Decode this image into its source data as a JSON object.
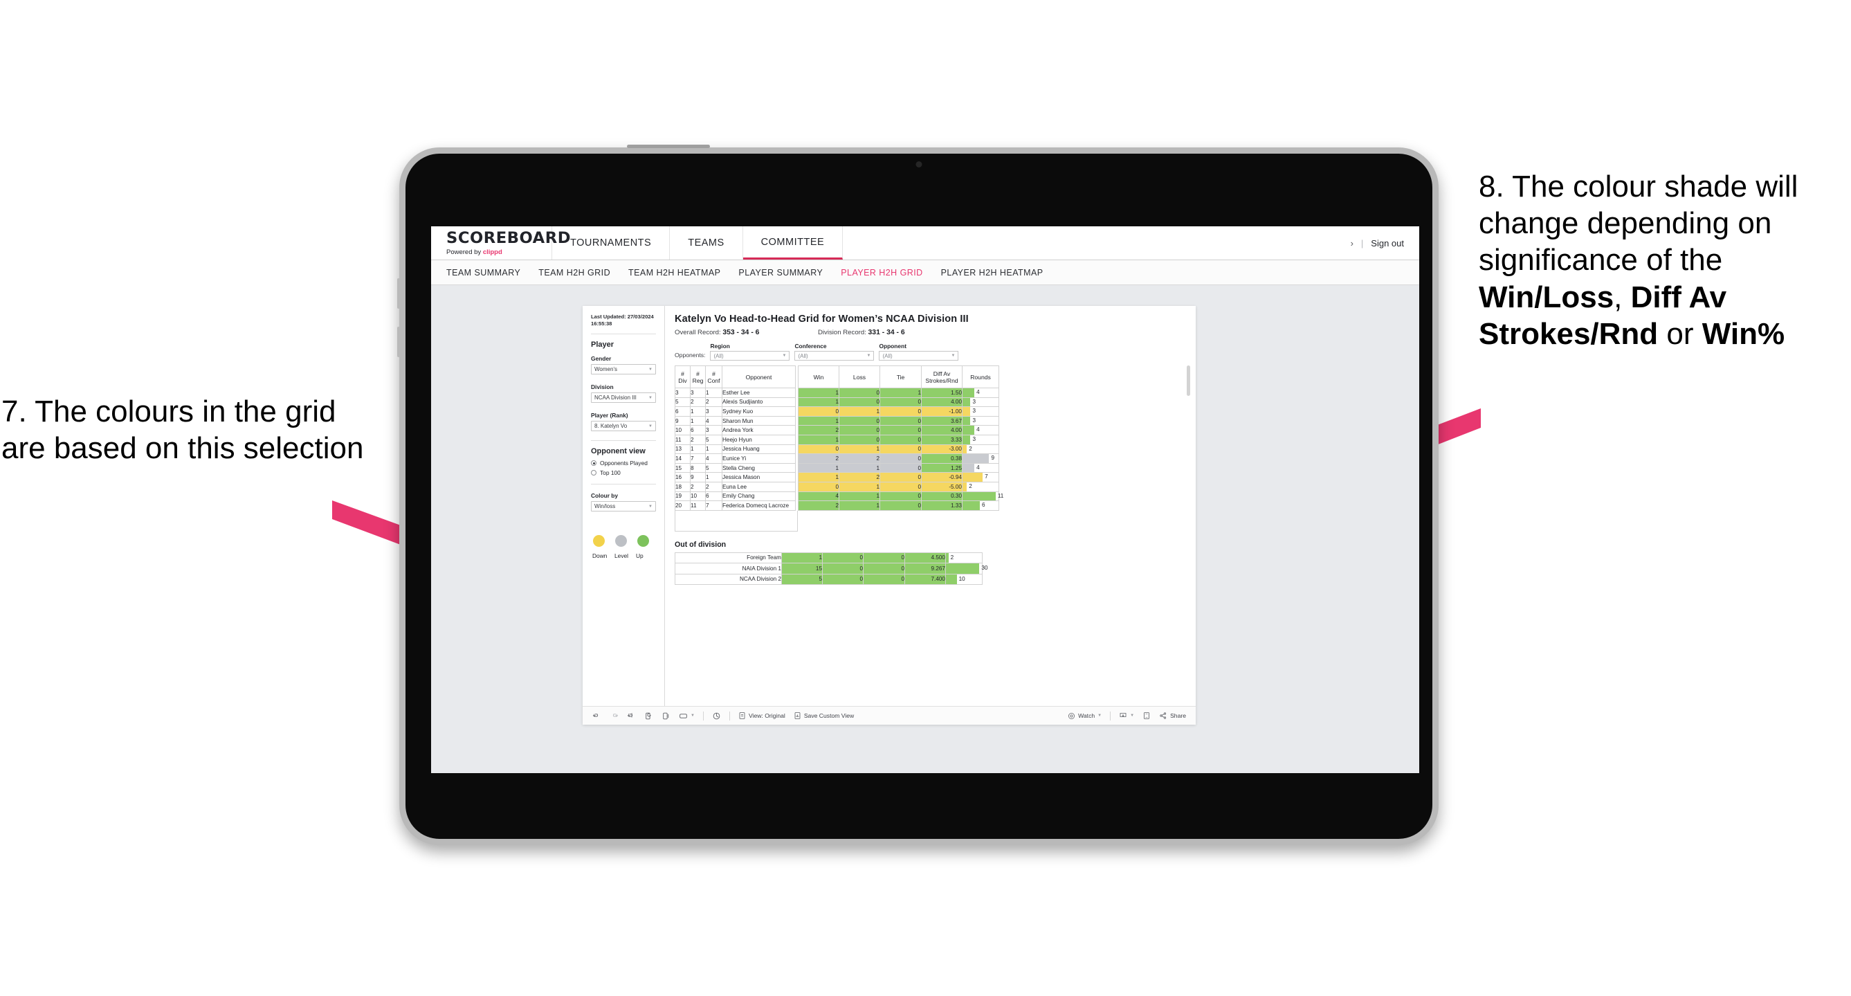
{
  "annotations": {
    "left": {
      "id": "7.",
      "text": "7. The colours in the grid are based on this selection"
    },
    "right": {
      "id": "8.",
      "prefix": "8. The colour shade will change depending on significance of the ",
      "bold1": "Win/Loss",
      "mid1": ", ",
      "bold2": "Diff Av Strokes/Rnd",
      "mid2": " or ",
      "bold3": "Win%"
    },
    "arrow_color": "#e8376f"
  },
  "app": {
    "brand": {
      "name": "SCOREBOARD",
      "sub_prefix": "Powered by ",
      "sub_brand": "clippd"
    },
    "nav_tabs": [
      {
        "label": "TOURNAMENTS",
        "active": false
      },
      {
        "label": "TEAMS",
        "active": false
      },
      {
        "label": "COMMITTEE",
        "active": true
      }
    ],
    "top_right": {
      "chevron": "›",
      "divider": "|",
      "sign_out": "Sign out"
    },
    "sub_tabs": [
      {
        "label": "TEAM SUMMARY",
        "active": false
      },
      {
        "label": "TEAM H2H GRID",
        "active": false
      },
      {
        "label": "TEAM H2H HEATMAP",
        "active": false
      },
      {
        "label": "PLAYER SUMMARY",
        "active": false
      },
      {
        "label": "PLAYER H2H GRID",
        "active": true
      },
      {
        "label": "PLAYER H2H HEATMAP",
        "active": false
      }
    ]
  },
  "sidebar": {
    "last_updated": "Last Updated: 27/03/2024 16:55:38",
    "player_heading": "Player",
    "fields": [
      {
        "label": "Gender",
        "value": "Women’s"
      },
      {
        "label": "Division",
        "value": "NCAA Division III"
      },
      {
        "label": "Player (Rank)",
        "value": "8. Katelyn Vo"
      }
    ],
    "opponent_view": {
      "heading": "Opponent view",
      "options": [
        {
          "label": "Opponents Played",
          "selected": true
        },
        {
          "label": "Top 100",
          "selected": false
        }
      ]
    },
    "colour_by": {
      "label": "Colour by",
      "value": "Win/loss"
    },
    "legend": {
      "swatches": [
        {
          "name": "Down",
          "color": "#f2d24b"
        },
        {
          "name": "Level",
          "color": "#bdc0c5"
        },
        {
          "name": "Up",
          "color": "#7dc25c"
        }
      ]
    }
  },
  "main": {
    "title": "Katelyn Vo Head-to-Head Grid for Women’s NCAA Division III",
    "overall_record_label": "Overall Record: ",
    "overall_record_value": "353 -  34 - 6",
    "division_record_label": "Division Record: ",
    "division_record_value": "331 -  34 - 6",
    "opponents_label": "Opponents:",
    "filters": [
      {
        "label": "Region",
        "value": "(All)"
      },
      {
        "label": "Conference",
        "value": "(All)"
      },
      {
        "label": "Opponent",
        "value": "(All)"
      }
    ],
    "columns": [
      "#\nDiv",
      "#\nReg",
      "#\nConf",
      "Opponent",
      "Win",
      "Loss",
      "Tie",
      "Diff Av\nStrokes/Rnd",
      "Rounds"
    ],
    "column_lines": [
      [
        "#",
        "Div"
      ],
      [
        "#",
        "Reg"
      ],
      [
        "#",
        "Conf"
      ],
      [
        "Opponent",
        ""
      ],
      [
        "Win",
        ""
      ],
      [
        "Loss",
        ""
      ],
      [
        "Tie",
        ""
      ],
      [
        "Diff Av",
        "Strokes/Rnd"
      ],
      [
        "Rounds",
        ""
      ]
    ],
    "rows": [
      {
        "div": "3",
        "reg": "3",
        "conf": "1",
        "opponent": "Esther Lee",
        "win": "1",
        "loss": "0",
        "tie": "1",
        "diff": "1.50",
        "rounds": "4",
        "color": "#8fce69",
        "rounds_pct": 33
      },
      {
        "div": "5",
        "reg": "2",
        "conf": "2",
        "opponent": "Alexis Sudjianto",
        "win": "1",
        "loss": "0",
        "tie": "0",
        "diff": "4.00",
        "rounds": "3",
        "color": "#8fce69",
        "rounds_pct": 22
      },
      {
        "div": "6",
        "reg": "1",
        "conf": "3",
        "opponent": "Sydney Kuo",
        "win": "0",
        "loss": "1",
        "tie": "0",
        "diff": "-1.00",
        "rounds": "3",
        "color": "#f5d761",
        "rounds_pct": 22
      },
      {
        "div": "9",
        "reg": "1",
        "conf": "4",
        "opponent": "Sharon Mun",
        "win": "1",
        "loss": "0",
        "tie": "0",
        "diff": "3.67",
        "rounds": "3",
        "color": "#8fce69",
        "rounds_pct": 22
      },
      {
        "div": "10",
        "reg": "6",
        "conf": "3",
        "opponent": "Andrea York",
        "win": "2",
        "loss": "0",
        "tie": "0",
        "diff": "4.00",
        "rounds": "4",
        "color": "#8fce69",
        "rounds_pct": 33
      },
      {
        "div": "11",
        "reg": "2",
        "conf": "5",
        "opponent": "Heejo Hyun",
        "win": "1",
        "loss": "0",
        "tie": "0",
        "diff": "3.33",
        "rounds": "3",
        "color": "#8fce69",
        "rounds_pct": 22
      },
      {
        "div": "13",
        "reg": "1",
        "conf": "1",
        "opponent": "Jessica Huang",
        "win": "0",
        "loss": "1",
        "tie": "0",
        "diff": "-3.00",
        "rounds": "2",
        "color": "#f5d761",
        "rounds_pct": 12
      },
      {
        "div": "14",
        "reg": "7",
        "conf": "4",
        "opponent": "Eunice Yi",
        "win": "2",
        "loss": "2",
        "tie": "0",
        "diff": "0.38",
        "rounds": "9",
        "color": "#c9cbd0",
        "diff_color": "#8fce69",
        "rounds_pct": 74
      },
      {
        "div": "15",
        "reg": "8",
        "conf": "5",
        "opponent": "Stella Cheng",
        "win": "1",
        "loss": "1",
        "tie": "0",
        "diff": "1.25",
        "rounds": "4",
        "color": "#c9cbd0",
        "diff_color": "#8fce69",
        "rounds_pct": 33
      },
      {
        "div": "16",
        "reg": "9",
        "conf": "1",
        "opponent": "Jessica Mason",
        "win": "1",
        "loss": "2",
        "tie": "0",
        "diff": "-0.94",
        "rounds": "7",
        "color": "#f5d761",
        "rounds_pct": 56
      },
      {
        "div": "18",
        "reg": "2",
        "conf": "2",
        "opponent": "Euna Lee",
        "win": "0",
        "loss": "1",
        "tie": "0",
        "diff": "-5.00",
        "rounds": "2",
        "color": "#f5d761",
        "rounds_pct": 12
      },
      {
        "div": "19",
        "reg": "10",
        "conf": "6",
        "opponent": "Emily Chang",
        "win": "4",
        "loss": "1",
        "tie": "0",
        "diff": "0.30",
        "rounds": "11",
        "color": "#8fce69",
        "rounds_pct": 92
      },
      {
        "div": "20",
        "reg": "11",
        "conf": "7",
        "opponent": "Federica Domecq Lacroze",
        "win": "2",
        "loss": "1",
        "tie": "0",
        "diff": "1.33",
        "rounds": "6",
        "color": "#8fce69",
        "rounds_pct": 48
      }
    ],
    "out_of_division": {
      "heading": "Out of division",
      "rows": [
        {
          "name": "Foreign Team",
          "win": "1",
          "loss": "0",
          "tie": "0",
          "diff": "4.500",
          "rounds": "2",
          "color": "#8fce69",
          "rounds_pct": 7
        },
        {
          "name": "NAIA Division 1",
          "win": "15",
          "loss": "0",
          "tie": "0",
          "diff": "9.267",
          "rounds": "30",
          "color": "#8fce69",
          "rounds_pct": 93
        },
        {
          "name": "NCAA Division 2",
          "win": "5",
          "loss": "0",
          "tie": "0",
          "diff": "7.400",
          "rounds": "10",
          "color": "#8fce69",
          "rounds_pct": 30
        }
      ]
    }
  },
  "toolbar": {
    "undo": "undo-icon",
    "redo": "redo-icon",
    "revert": "revert-icon",
    "refresh": "refresh-data-icon",
    "pause": "pause-updates-icon",
    "device": "device-layout-icon",
    "highlight": "highlight-icon",
    "view_label": "View: Original",
    "save_label": "Save Custom View",
    "watch_label": "Watch",
    "download": "download-icon",
    "fullscreen": "fullscreen-icon",
    "share_label": "Share"
  }
}
